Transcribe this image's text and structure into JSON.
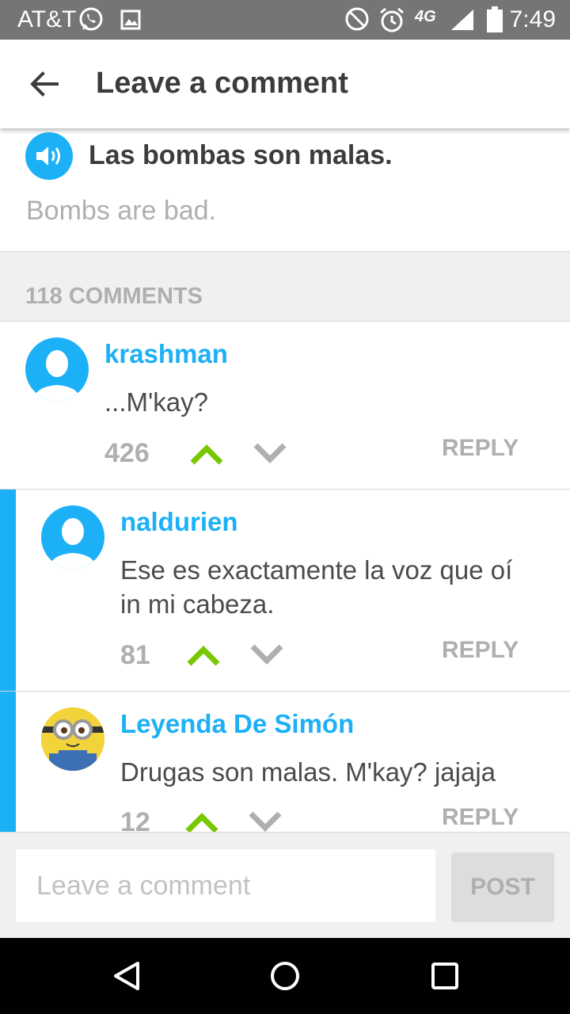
{
  "status_bar": {
    "carrier": "AT&T",
    "time": "7:49",
    "icons": [
      "whatsapp-icon",
      "image-icon",
      "do-not-disturb-icon",
      "alarm-icon",
      "4g-lte-icon",
      "signal-icon",
      "battery-icon"
    ],
    "network_label": "4G"
  },
  "app_bar": {
    "title": "Leave a comment",
    "back_icon": "arrow-left-icon"
  },
  "sentence": {
    "text": "Las bombas son malas.",
    "translation": "Bombs are bad.",
    "audio_icon": "speaker-icon"
  },
  "comments_header": {
    "count_label": "118 COMMENTS"
  },
  "comments": [
    {
      "username": "krashman",
      "text": "...M'kay?",
      "votes": "426",
      "reply_label": "REPLY",
      "avatar": "default-avatar-icon"
    },
    {
      "username": "naldurien",
      "text": "Ese es exactamente la voz que oí in mi cabeza.",
      "votes": "81",
      "reply_label": "REPLY",
      "avatar": "default-avatar-icon"
    },
    {
      "username": "Leyenda De Simón",
      "text": "Drugas son malas. M'kay? jajaja",
      "votes": "12",
      "reply_label": "REPLY",
      "avatar": "minion-avatar"
    }
  ],
  "composer": {
    "placeholder": "Leave a comment",
    "value": "",
    "post_label": "POST"
  },
  "colors": {
    "accent": "#1cb0f6",
    "upvote": "#78c800",
    "status_bar": "#757575",
    "muted_text": "#afafaf"
  },
  "nav_bar": {
    "icons": [
      "back-triangle-icon",
      "home-circle-icon",
      "recents-square-icon"
    ]
  }
}
